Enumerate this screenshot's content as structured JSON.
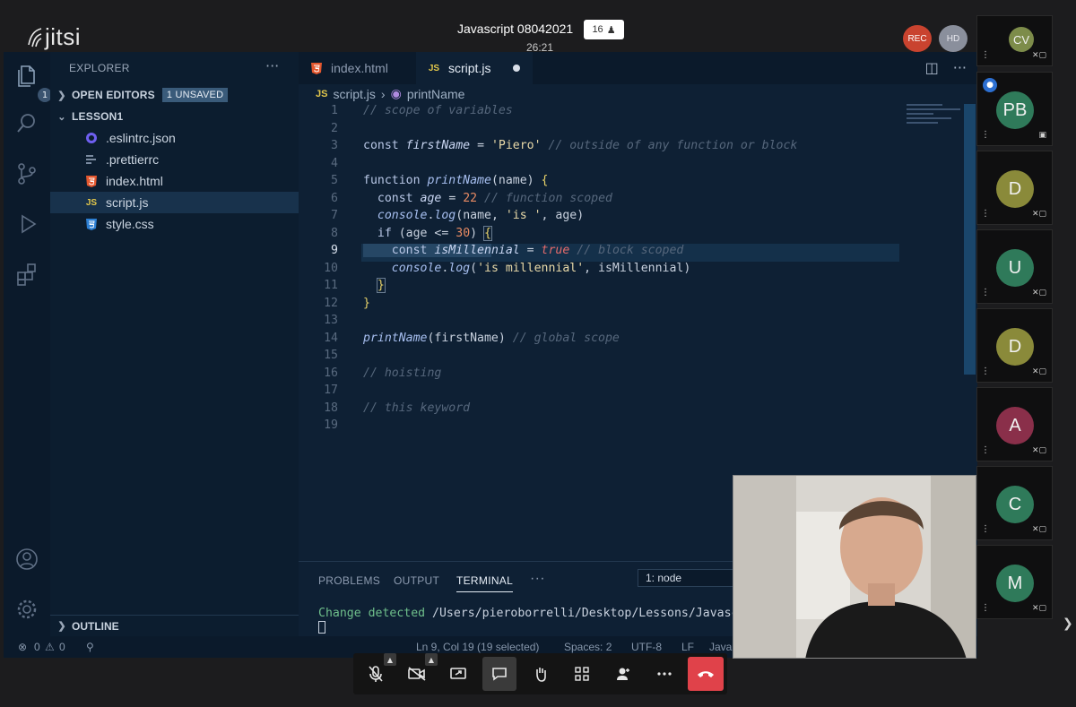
{
  "jitsi": {
    "logo_text": "jitsi",
    "meeting_title": "Javascript 08042021",
    "participant_count": "16",
    "timer": "26:21",
    "rec_label": "REC",
    "hd_label": "HD"
  },
  "vscode": {
    "explorer_title": "EXPLORER",
    "explorer_more": "···",
    "activity_badge": "1",
    "open_editors_label": "OPEN EDITORS",
    "unsaved_badge": "1 UNSAVED",
    "folder_label": "LESSON1",
    "files": [
      {
        "name": ".eslintrc.json",
        "icon": "eslint-icon"
      },
      {
        "name": ".prettierrc",
        "icon": "prettier-icon"
      },
      {
        "name": "index.html",
        "icon": "html5-icon"
      },
      {
        "name": "script.js",
        "icon": "js-icon"
      },
      {
        "name": "style.css",
        "icon": "css3-icon"
      }
    ],
    "outline_label": "OUTLINE",
    "tabs": [
      {
        "label": "index.html",
        "icon": "html5-icon"
      },
      {
        "label": "script.js",
        "icon": "js-icon"
      }
    ],
    "breadcrumb": {
      "file": "script.js",
      "symbol": "printName"
    },
    "code_line_numbers": [
      "1",
      "2",
      "3",
      "4",
      "5",
      "6",
      "7",
      "8",
      "9",
      "10",
      "11",
      "12",
      "13",
      "14",
      "15",
      "16",
      "17",
      "18",
      "19"
    ],
    "panel_tabs": [
      "PROBLEMS",
      "OUTPUT",
      "TERMINAL"
    ],
    "panel_more": "···",
    "terminal_select": "1: node",
    "terminal_line_status": "Change detected",
    "terminal_line_path": "/Users/pieroborrelli/Desktop/Lessons/Javascri",
    "status": {
      "errors": "0",
      "warnings": "0",
      "position": "Ln 9, Col 19 (19 selected)",
      "spaces": "Spaces: 2",
      "encoding": "UTF-8",
      "eol": "LF",
      "language": "Java"
    }
  },
  "participants": [
    {
      "initials": "CV",
      "color": "#7d8c4a"
    },
    {
      "initials": "PB",
      "color": "#2f7a5a"
    },
    {
      "initials": "D",
      "color": "#8a8a3a"
    },
    {
      "initials": "U",
      "color": "#2f7a5a"
    },
    {
      "initials": "D",
      "color": "#8a8a3a"
    },
    {
      "initials": "A",
      "color": "#8a2f4a"
    },
    {
      "initials": "C",
      "color": "#2f7a5a"
    },
    {
      "initials": "M",
      "color": "#2f7a5a"
    }
  ],
  "toolbar": {
    "buttons": [
      "microphone-muted-icon",
      "camera-off-icon",
      "share-screen-icon",
      "chat-icon",
      "raise-hand-icon",
      "tile-view-icon",
      "invite-icon",
      "more-icon",
      "hangup-icon"
    ]
  }
}
